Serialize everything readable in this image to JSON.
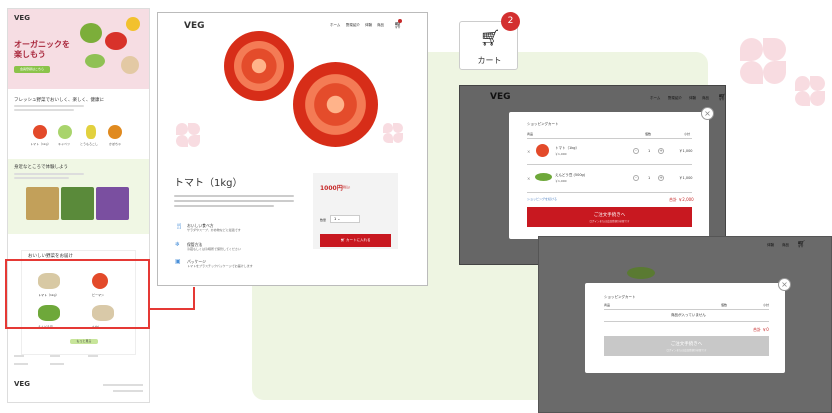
{
  "long_page": {
    "logo": "VEG",
    "hero_title": "オーガニックを\n楽しもう",
    "hero_button": "会員登録はこちら",
    "section1_title": "フレッシュ野菜でおいしく、楽しく、健康に",
    "section2_title": "身近なところで体験しよう",
    "section3_title": "おいしい野菜をお届け",
    "vegetables": [
      "トマト（1kg）",
      "キャベツ",
      "とうもろこし",
      "かぼちゃ"
    ],
    "products": [
      "トマト（1kg）",
      "ピーマン",
      "えんどう豆",
      "もやし"
    ],
    "more_button": "もっと見る",
    "footer_logo": "VEG"
  },
  "product_page": {
    "logo": "VEG",
    "nav": [
      "ホーム",
      "野菜紹介",
      "体験",
      "商品"
    ],
    "title": "トマト（1kg）",
    "features": [
      {
        "title": "おいしい食べ方",
        "desc": "サラダやスープ、炒め物などに最適です"
      },
      {
        "title": "保管方法",
        "desc": "冷蔵もしくは冷暗所で保管してください"
      },
      {
        "title": "パッケージ",
        "desc": "トマトをプラスチックパッケージでお届けします"
      }
    ],
    "price": "1000円",
    "tax": "(税込)",
    "qty_label": "数量",
    "qty_value": "1",
    "add_button": "カートに入れる"
  },
  "cart_icon": {
    "label": "カート",
    "badge": "2"
  },
  "modal_filled": {
    "logo": "VEG",
    "nav": [
      "ホーム",
      "野菜紹介",
      "体験",
      "商品"
    ],
    "title": "ショッピングカート",
    "col_product": "商品",
    "col_qty": "個数",
    "col_subtotal": "小計",
    "items": [
      {
        "name": "トマト（1kg）",
        "price": "￥1,000",
        "qty": "1",
        "subtotal": "￥1,000"
      },
      {
        "name": "えんどう豆 (500g)",
        "price": "￥1,000",
        "qty": "1",
        "subtotal": "￥1,000"
      }
    ],
    "continue_link": "ショッピングを続ける",
    "total": "合計 ￥2,000",
    "checkout_title": "ご注文手続きへ",
    "checkout_sub": "ログインまたは会員登録が必要です"
  },
  "modal_empty": {
    "nav": [
      "体験",
      "商品"
    ],
    "title": "ショッピングカート",
    "col_product": "商品",
    "col_qty": "個数",
    "col_subtotal": "小計",
    "empty_message": "商品が入っていません",
    "total": "合計 ￥0",
    "checkout_title": "ご注文手続きへ",
    "checkout_sub": "ログインまたは会員登録が必要です"
  },
  "colors": {
    "accent_red": "#c81820",
    "brand_green": "#8bc34a",
    "hero_pink": "#f6dde3",
    "bg_green": "#eef5e2"
  }
}
